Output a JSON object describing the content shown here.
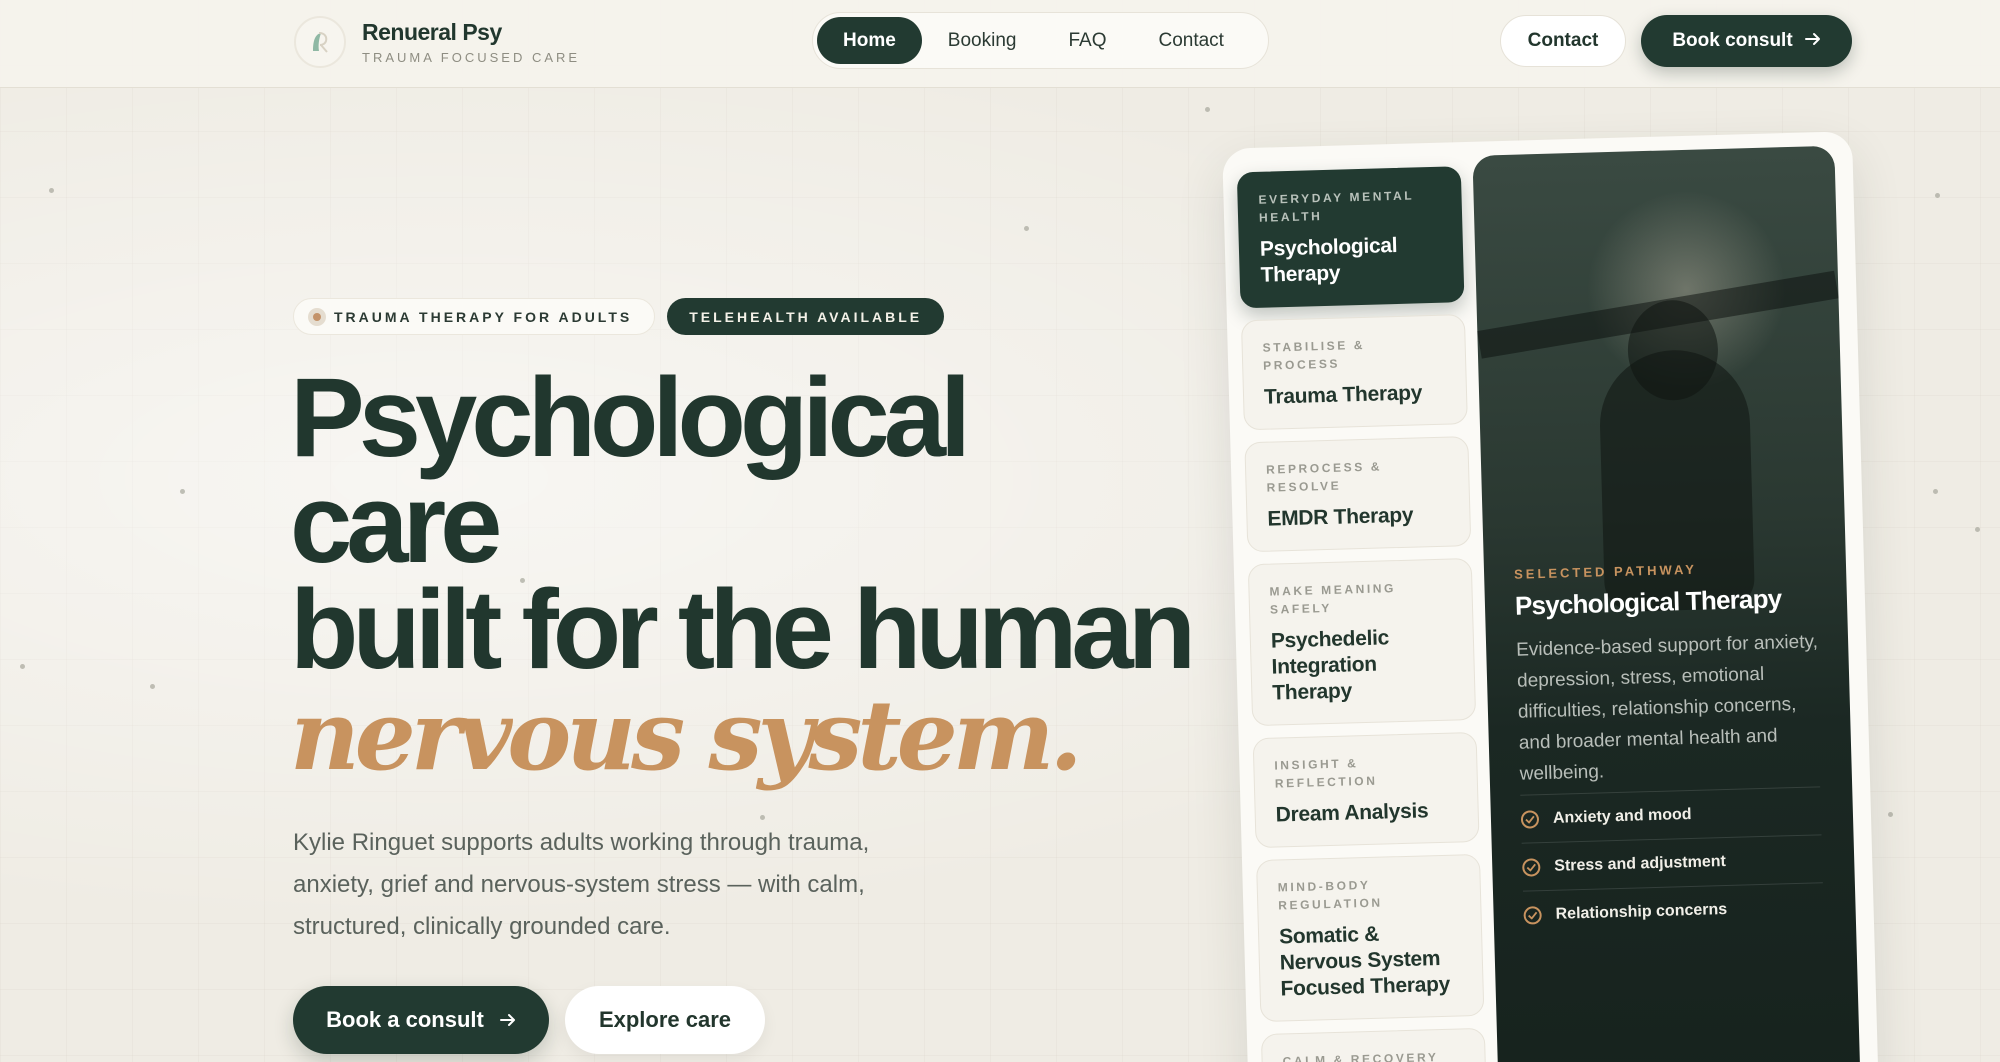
{
  "brand": {
    "name": "Renueral Psy",
    "tagline": "TRAUMA FOCUSED CARE"
  },
  "nav": {
    "items": [
      {
        "label": "Home",
        "active": true
      },
      {
        "label": "Booking",
        "active": false
      },
      {
        "label": "FAQ",
        "active": false
      },
      {
        "label": "Contact",
        "active": false
      }
    ]
  },
  "header_actions": {
    "contact_label": "Contact",
    "book_label": "Book consult"
  },
  "hero": {
    "badge_primary": "TRAUMA THERAPY FOR ADULTS",
    "badge_secondary": "TELEHEALTH AVAILABLE",
    "headline_line1": "Psychological",
    "headline_line2": "care",
    "headline_line3": "built for the human",
    "headline_accent": "nervous system.",
    "lead": "Kylie Ringuet supports adults working through trauma, anxiety, grief and nervous-system stress — with calm, structured, clinically grounded care.",
    "cta_primary": "Book a consult",
    "cta_secondary": "Explore care"
  },
  "pathways": [
    {
      "kicker": "EVERYDAY MENTAL HEALTH",
      "title": "Psychological Therapy",
      "active": true
    },
    {
      "kicker": "STABILISE & PROCESS",
      "title": "Trauma Therapy",
      "active": false
    },
    {
      "kicker": "REPROCESS & RESOLVE",
      "title": "EMDR Therapy",
      "active": false
    },
    {
      "kicker": "MAKE MEANING SAFELY",
      "title": "Psychedelic Integration Therapy",
      "active": false
    },
    {
      "kicker": "INSIGHT & REFLECTION",
      "title": "Dream Analysis",
      "active": false
    },
    {
      "kicker": "MIND-BODY REGULATION",
      "title": "Somatic & Nervous System Focused Therapy",
      "active": false
    },
    {
      "kicker": "CALM & RECOVERY",
      "title": "",
      "active": false
    }
  ],
  "selected": {
    "kicker": "SELECTED PATHWAY",
    "title": "Psychological Therapy",
    "description": "Evidence-based support for anxiety, depression, stress, emotional difficulties, relationship concerns, and broader mental health and wellbeing.",
    "points": [
      "Anxiety and mood",
      "Stress and adjustment",
      "Relationship concerns"
    ]
  },
  "icons": {
    "arrow": "arrow-right-icon",
    "check": "check-circle-icon",
    "logo": "logo-mark-icon"
  },
  "colors": {
    "primary": "#223a31",
    "accent": "#c8935f",
    "background": "#efece4"
  }
}
